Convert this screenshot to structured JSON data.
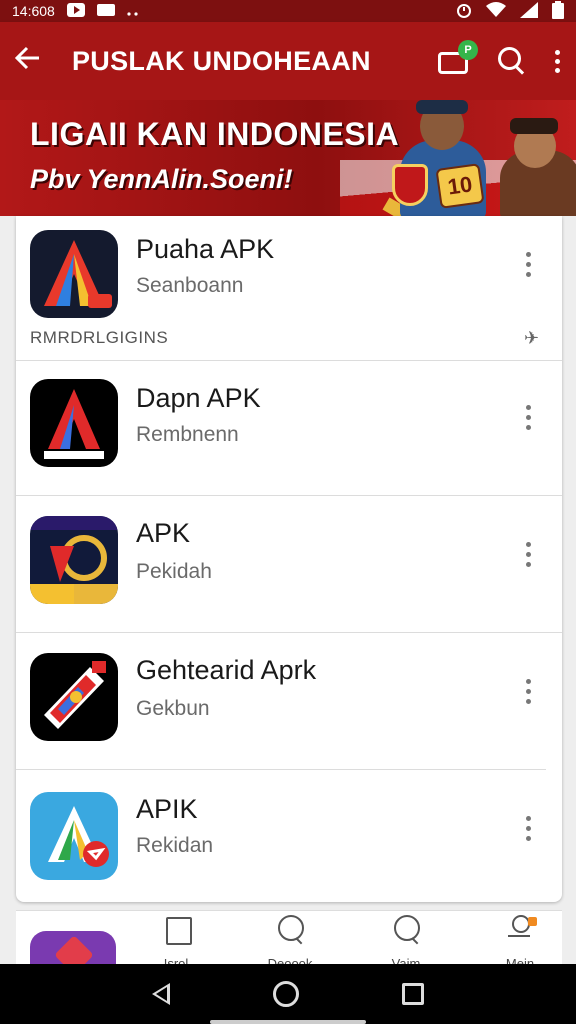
{
  "status_bar": {
    "time": "14:608"
  },
  "app_bar": {
    "title": "PUSLAK UNDOHEAAN",
    "chat_badge": "P"
  },
  "banner": {
    "headline": "LIGAII KAN INDONESIA",
    "tagline": "Pbv YennAlin.Soeni!",
    "badge_number": "10"
  },
  "apps": [
    {
      "name": "Puaha APK",
      "subtitle": "Seanboann"
    },
    {
      "name": "Dapn APK",
      "subtitle": "Rembnenn"
    },
    {
      "name": "APK",
      "subtitle": "Pekidah"
    },
    {
      "name": "Gehtearid Aprk",
      "subtitle": "Gekbun"
    },
    {
      "name": "APIK",
      "subtitle": "Rekidan"
    }
  ],
  "section_label": "RMRDRLGIGINS",
  "bottom_nav": [
    {
      "label": "Isrol",
      "icon": "flag-icon"
    },
    {
      "label": "Deoook",
      "icon": "search-icon"
    },
    {
      "label": "Vaim",
      "icon": "search-icon"
    },
    {
      "label": "Mein",
      "icon": "profile-icon"
    }
  ],
  "colors": {
    "app_bar": "#a61616",
    "status_bar": "#7d1010",
    "accent_green": "#35b54a"
  }
}
